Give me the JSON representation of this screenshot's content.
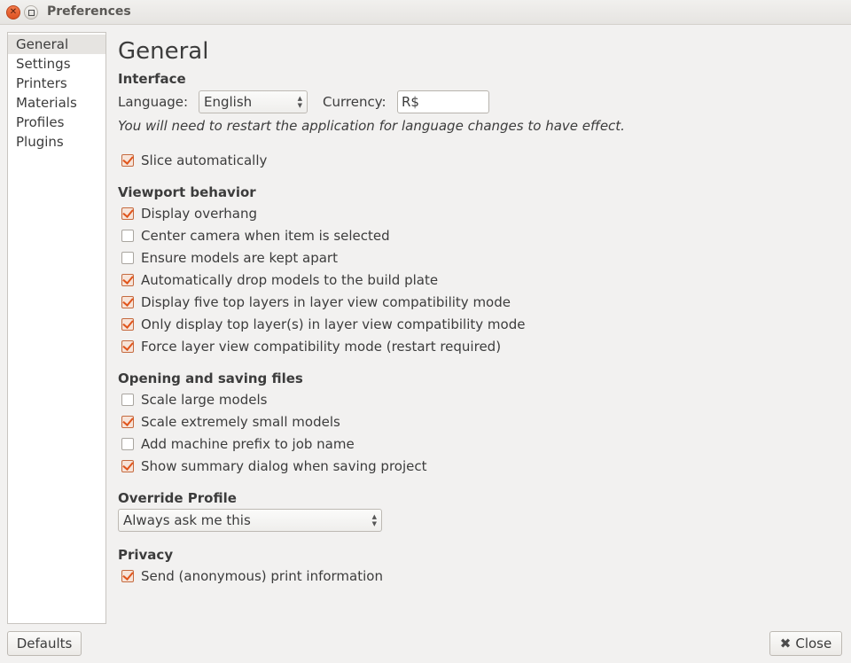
{
  "window": {
    "title": "Preferences"
  },
  "sidebar": {
    "items": [
      {
        "label": "General",
        "active": true
      },
      {
        "label": "Settings"
      },
      {
        "label": "Printers"
      },
      {
        "label": "Materials"
      },
      {
        "label": "Profiles"
      },
      {
        "label": "Plugins"
      }
    ]
  },
  "main": {
    "title": "General",
    "interface": {
      "heading": "Interface",
      "language_label": "Language:",
      "language_value": "English",
      "currency_label": "Currency:",
      "currency_value": "R$",
      "restart_note": "You will need to restart the application for language changes to have effect."
    },
    "slice_auto": {
      "label": "Slice automatically",
      "checked": true
    },
    "viewport": {
      "heading": "Viewport behavior",
      "options": [
        {
          "label": "Display overhang",
          "checked": true
        },
        {
          "label": "Center camera when item is selected",
          "checked": false
        },
        {
          "label": "Ensure models are kept apart",
          "checked": false
        },
        {
          "label": "Automatically drop models to the build plate",
          "checked": true
        },
        {
          "label": "Display five top layers in layer view compatibility mode",
          "checked": true
        },
        {
          "label": "Only display top layer(s) in layer view compatibility mode",
          "checked": true
        },
        {
          "label": "Force layer view compatibility mode (restart required)",
          "checked": true
        }
      ]
    },
    "files": {
      "heading": "Opening and saving files",
      "options": [
        {
          "label": "Scale large models",
          "checked": false
        },
        {
          "label": "Scale extremely small models",
          "checked": true
        },
        {
          "label": "Add machine prefix to job name",
          "checked": false
        },
        {
          "label": "Show summary dialog when saving project",
          "checked": true
        }
      ]
    },
    "override": {
      "heading": "Override Profile",
      "value": "Always ask me this"
    },
    "privacy": {
      "heading": "Privacy",
      "options": [
        {
          "label": "Send (anonymous) print information",
          "checked": true
        }
      ]
    }
  },
  "footer": {
    "defaults_label": "Defaults",
    "close_label": "Close"
  },
  "colors": {
    "accent": "#e0551c",
    "background": "#f2f1f0"
  }
}
